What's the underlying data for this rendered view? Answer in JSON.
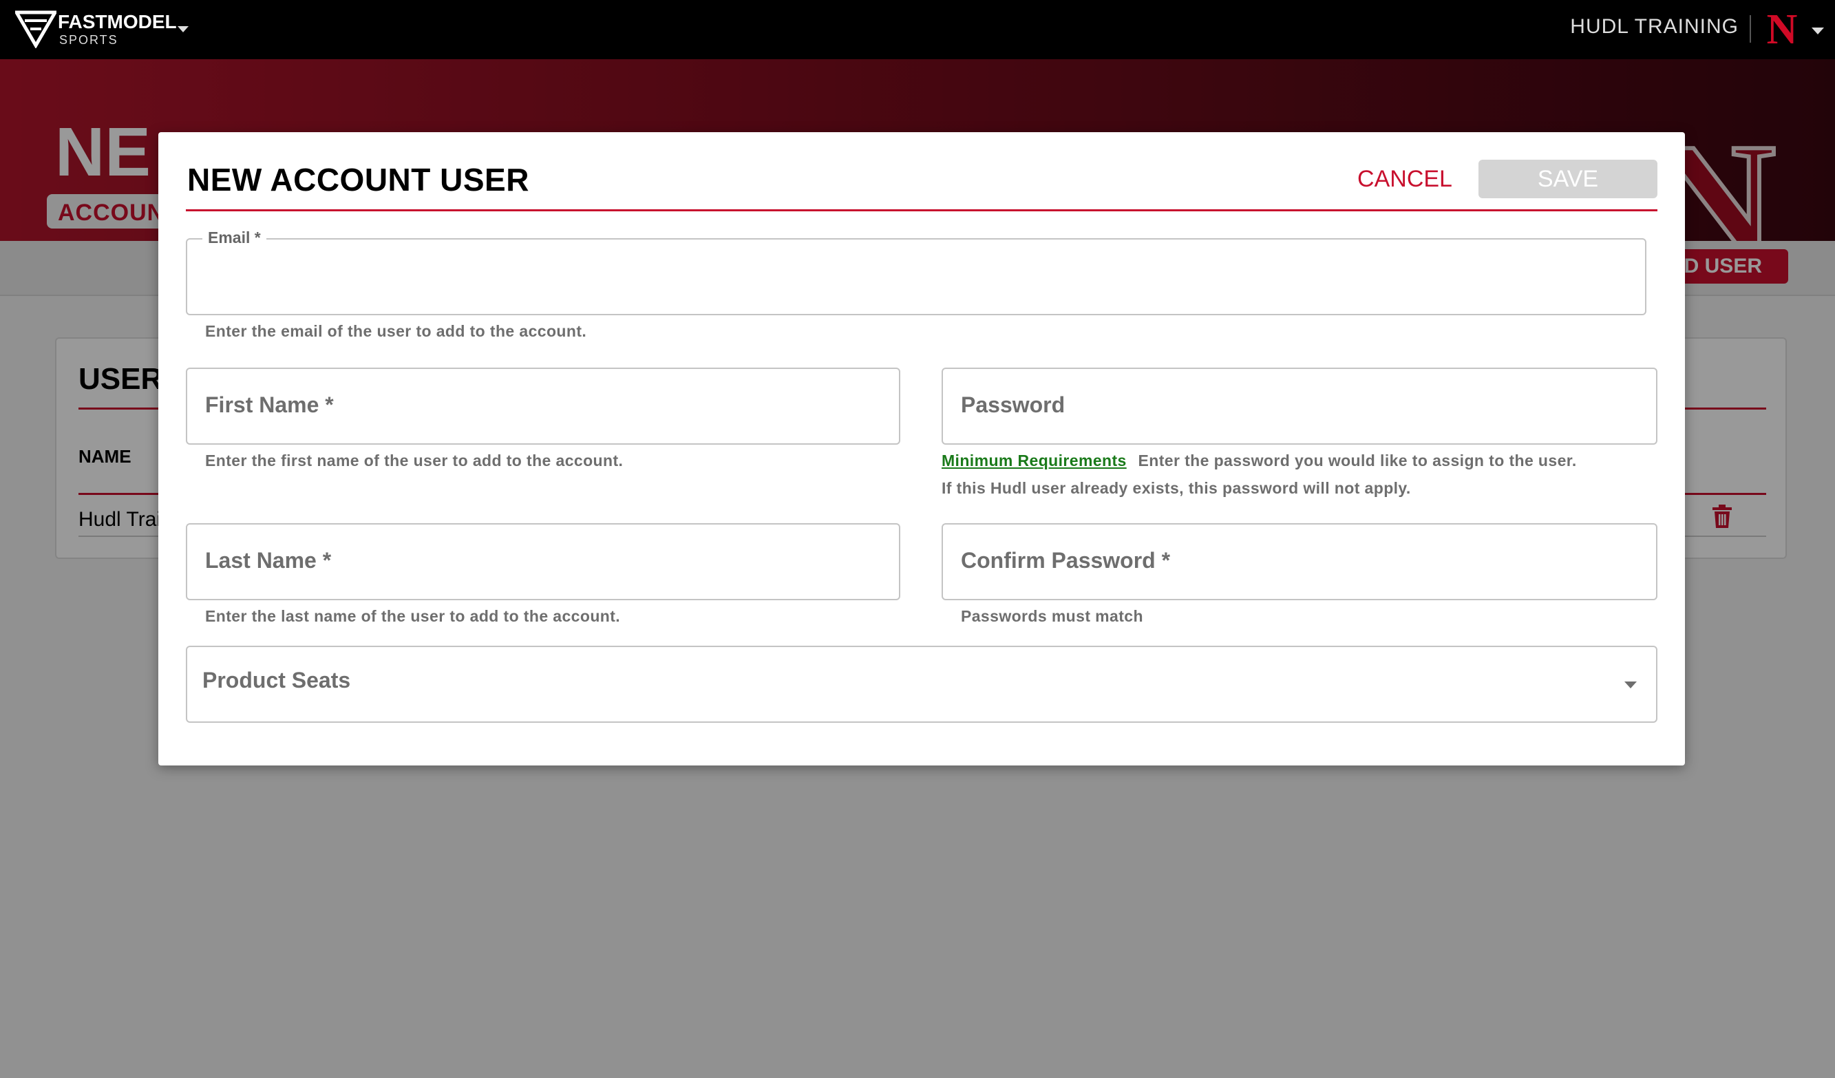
{
  "topnav": {
    "brand_name": "FASTMODEL",
    "brand_sub": "SPORTS",
    "team_name": "HUDL TRAINING",
    "team_logo": "N"
  },
  "background_page": {
    "hero_title": "NE",
    "hero_badge": "ACCOUN",
    "hero_logo": "N",
    "add_user_label": "D USER",
    "users_title": "USERS",
    "col_name": "NAME",
    "row_name": "Hudl Trai"
  },
  "modal": {
    "title": "NEW ACCOUNT USER",
    "cancel_label": "CANCEL",
    "save_label": "SAVE",
    "email": {
      "legend": "Email *",
      "value": "",
      "helper": "Enter the email of the user to add to the account."
    },
    "first_name": {
      "placeholder": "First Name *",
      "value": "",
      "helper": "Enter the first name of the user to add to the account."
    },
    "password": {
      "placeholder": "Password",
      "value": "",
      "min_req_link": "Minimum Requirements",
      "helper1": "Enter the password you would like to assign to the user.",
      "helper2": "If this Hudl user already exists, this password will not apply."
    },
    "last_name": {
      "placeholder": "Last Name *",
      "value": "",
      "helper": "Enter the last name of the user to add to the account."
    },
    "confirm_password": {
      "placeholder": "Confirm Password *",
      "value": "",
      "helper": "Passwords must match"
    },
    "product_seats": {
      "placeholder": "Product Seats"
    }
  },
  "colors": {
    "accent": "#c8102e",
    "link_green": "#1a7a1a",
    "save_disabled": "#d4d4d4"
  },
  "icons": [
    "fastmodel-logo-icon",
    "chevron-down-icon",
    "team-logo-icon",
    "trash-icon",
    "select-caret-icon"
  ]
}
